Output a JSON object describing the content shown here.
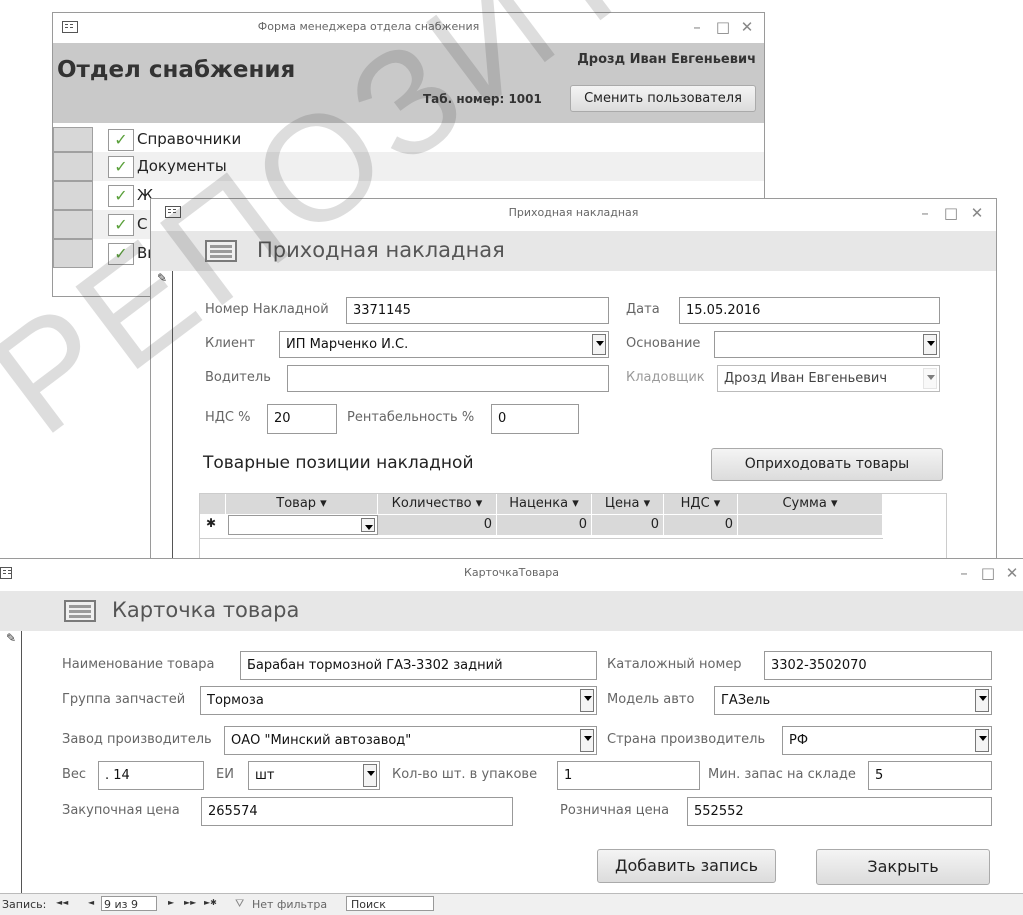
{
  "main_window": {
    "title": "Форма менеджера отдела снабжения",
    "department": "Отдел снабжения",
    "user_name": "Дрозд Иван Евгеньевич",
    "tab_number": "Таб. номер: 1001",
    "change_user": "Сменить пользователя",
    "menu": [
      {
        "label": "Справочники"
      },
      {
        "label": "Документы"
      },
      {
        "label": "Ж"
      },
      {
        "label": "С"
      },
      {
        "label": "Вы"
      }
    ]
  },
  "invoice_window": {
    "title": "Приходная накладная",
    "header": "Приходная накладная",
    "fields": {
      "number_label": "Номер Накладной",
      "number_value": "3371145",
      "date_label": "Дата",
      "date_value": "15.05.2016",
      "client_label": "Клиент",
      "client_value": "ИП Марченко И.С.",
      "basis_label": "Основание",
      "basis_value": "",
      "driver_label": "Водитель",
      "driver_value": "",
      "storekeeper_label": "Кладовщик",
      "storekeeper_value": "Дрозд Иван Евгеньевич",
      "vat_label": "НДС %",
      "vat_value": "20",
      "profit_label": "Рентабельность %",
      "profit_value": "0"
    },
    "section_title": "Товарные позиции накладной",
    "receive_button": "Оприходовать товары",
    "grid": {
      "columns": [
        "Товар",
        "Количество",
        "Наценка",
        "Цена",
        "НДС",
        "Сумма"
      ],
      "new_row_marker": "✱",
      "new_row": [
        "",
        "0",
        "0",
        "0",
        "0",
        ""
      ]
    }
  },
  "card_window": {
    "title": "КарточкаТовара",
    "header": "Карточка товара",
    "fields": {
      "name_label": "Наименование товара",
      "name_value": "Барабан тормозной ГАЗ-3302 задний",
      "catalog_label": "Каталожный номер",
      "catalog_value": "3302-3502070",
      "group_label": "Группа запчастей",
      "group_value": "Тормоза",
      "model_label": "Модель авто",
      "model_value": "ГАЗель",
      "maker_label": "Завод производитель",
      "maker_value": "ОАО \"Минский автозавод\"",
      "country_label": "Страна производитель",
      "country_value": "РФ",
      "weight_label": "Вес",
      "weight_value": ". 14",
      "unit_label": "ЕИ",
      "unit_value": "шт",
      "pack_label": "Кол-во шт. в упакове",
      "pack_value": "1",
      "min_stock_label": "Мин. запас на складе",
      "min_stock_value": "5",
      "purchase_label": "Закупочная цена",
      "purchase_value": "265574",
      "retail_label": "Розничная цена",
      "retail_value": "552552"
    },
    "add_button": "Добавить запись",
    "close_button": "Закрыть"
  },
  "nav_bar": {
    "record_label": "Запись:",
    "first": "◄◄",
    "prev": "◄",
    "position": "9 из 9",
    "next": "►",
    "last": "►►",
    "new": "►✱",
    "filter": "Нет фильтра",
    "search": "Поиск"
  },
  "watermark": "РЕПОЗИТОРИЙ ГГУ ИМ",
  "window_controls": {
    "minimize": "–",
    "maximize": "□",
    "close": "✕"
  },
  "colors": {
    "header_band": "#e7e7e7",
    "title_band": "#c9c9c9",
    "check": "#5aa03a"
  }
}
